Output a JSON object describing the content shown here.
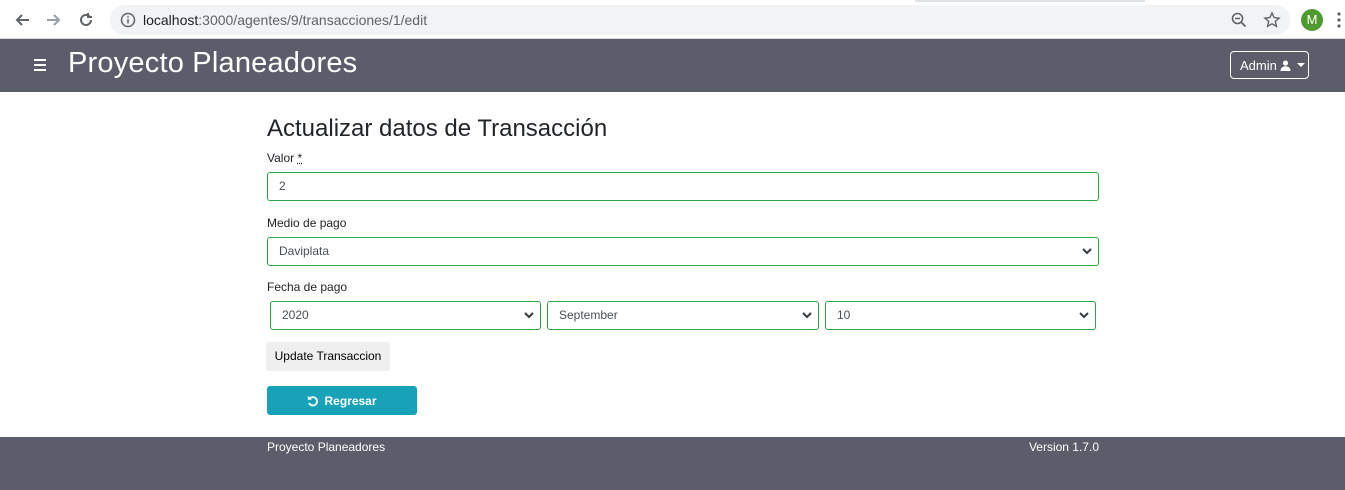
{
  "browser": {
    "url_host": "localhost",
    "url_path": ":3000/agentes/9/transacciones/1/edit",
    "profile_initial": "M"
  },
  "navbar": {
    "brand": "Proyecto Planeadores",
    "user_menu_label": "Admin"
  },
  "form": {
    "title": "Actualizar datos de Transacción",
    "valor_label": "Valor",
    "valor_required_mark": "*",
    "valor_value": "2",
    "medio_label": "Medio de pago",
    "medio_selected": "Daviplata",
    "fecha_label": "Fecha de pago",
    "fecha_year": "2020",
    "fecha_month": "September",
    "fecha_day": "10",
    "submit_label": "Update Transaccion",
    "back_label": "Regresar"
  },
  "footer": {
    "app_name": "Proyecto Planeadores",
    "version": "Version 1.7.0"
  },
  "colors": {
    "navbar_bg": "#5b5d6b",
    "valid_border": "#28a745",
    "back_button": "#17a2b8"
  }
}
